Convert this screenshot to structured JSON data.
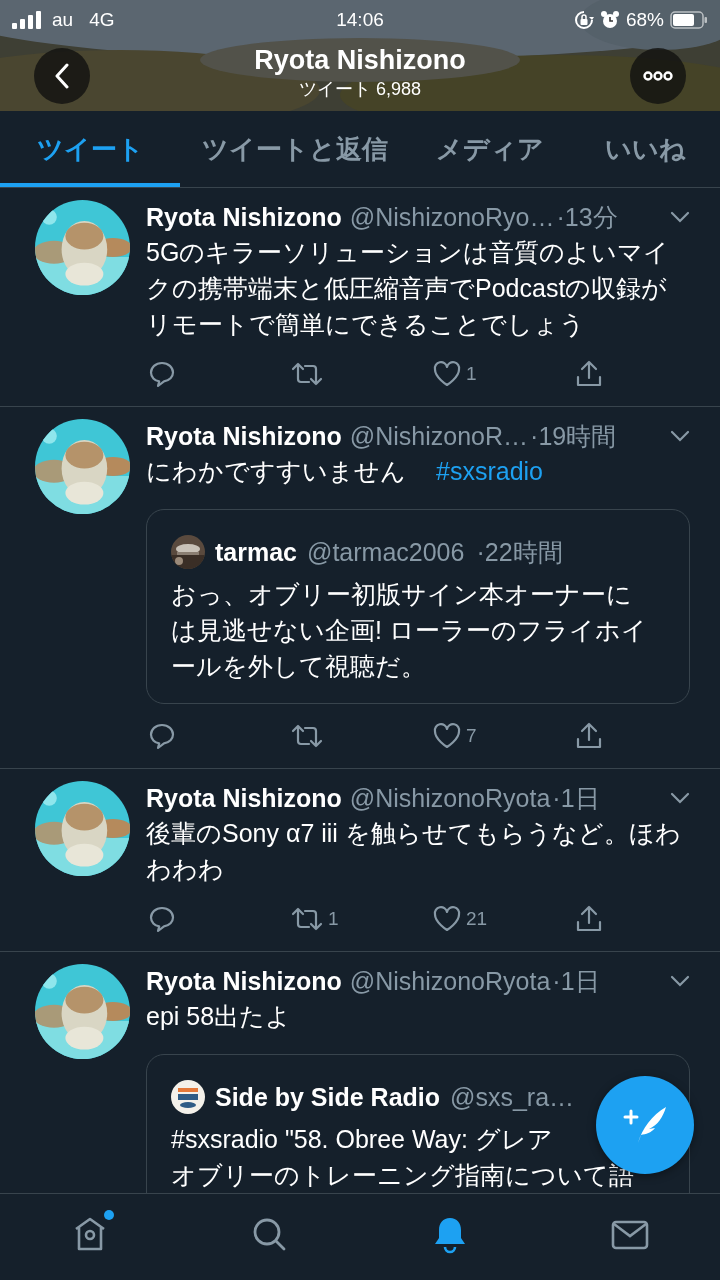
{
  "status_bar": {
    "carrier": "au",
    "network": "4G",
    "time": "14:06",
    "battery": "68%"
  },
  "header": {
    "title": "Ryota Nishizono",
    "subtitle": "ツイート 6,988"
  },
  "tabs": [
    {
      "label": "ツイート",
      "selected": true
    },
    {
      "label": "ツイートと返信",
      "selected": false
    },
    {
      "label": "メディア",
      "selected": false
    },
    {
      "label": "いいね",
      "selected": false
    }
  ],
  "tweets": [
    {
      "name": "Ryota Nishizono",
      "handle": "@NishizonoRyo…",
      "time": "·13分",
      "text": "5Gのキラーソリューションは音質のよいマイクの携帯端末と低圧縮音声でPodcastの収録がリモートで簡単にできることでしょう",
      "actions": {
        "like_count": "1"
      }
    },
    {
      "name": "Ryota Nishizono",
      "handle": "@NishizonoR…",
      "time": "·19時間",
      "text": "にわかですすいません",
      "hashtag": "#sxsradio",
      "quote": {
        "name": "tarmac",
        "handle": "@tarmac2006",
        "time": "·22時間",
        "text_lines": [
          "おっ、オブリー初版サイン本オーナーに",
          "は見逃せない企画! ローラーのフライホイ",
          "ールを外して視聴だ。"
        ]
      },
      "actions": {
        "like_count": "7"
      }
    },
    {
      "name": "Ryota Nishizono",
      "handle": "@NishizonoRyota",
      "time": "·1日",
      "text": "後輩のSony α7 iii を触らせてもらうなど。ほわわわわ",
      "actions": {
        "retweet_count": "1",
        "like_count": "21"
      }
    },
    {
      "name": "Ryota Nishizono",
      "handle": "@NishizonoRyota",
      "time": "·1日",
      "text": "epi 58出たよ",
      "quote": {
        "kind": "logo",
        "name": "Side by Side Radio",
        "handle": "@sxs_ra…",
        "text_lines": [
          "#sxsradio \"58. Obree Way: グレア",
          "オブリーのトレーニング指南について語"
        ]
      }
    }
  ],
  "bottom_nav": [
    {
      "kind": "home",
      "selected": false,
      "has_dot": true
    },
    {
      "kind": "search",
      "selected": false
    },
    {
      "kind": "bell",
      "selected": true
    },
    {
      "kind": "mail",
      "selected": false
    }
  ]
}
